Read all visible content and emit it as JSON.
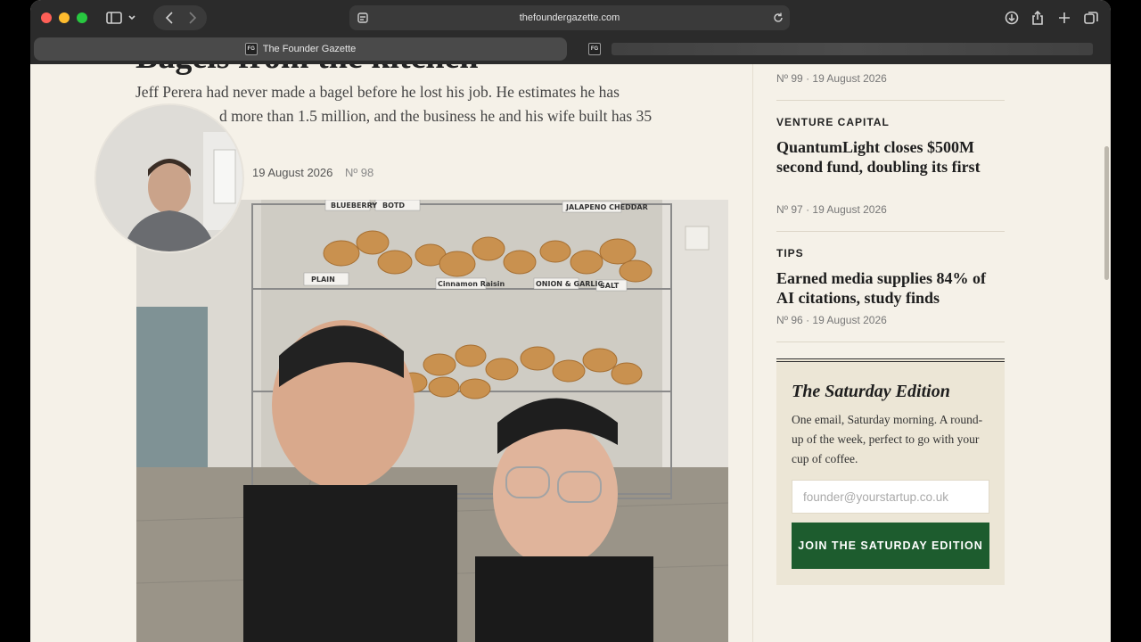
{
  "browser": {
    "url": "thefoundergazette.com",
    "tabs": [
      {
        "title": "The Founder Gazette",
        "favicon_text": "FG",
        "active": true
      },
      {
        "title": "",
        "favicon_text": "FG",
        "active": false
      }
    ]
  },
  "article": {
    "headline_partial": "Bagels from the kitchen",
    "standfirst_line1": "Jeff Perera had never made a bagel before he lost his job. He estimates he has",
    "standfirst_line2": "d more than 1.5 million, and the business he and his wife built has 35",
    "date": "19 August 2026",
    "issue": "Nº 98"
  },
  "sidebar": {
    "top_meta": "Nº 99 · 19 August 2026",
    "items": [
      {
        "category": "VENTURE CAPITAL",
        "title": "QuantumLight closes $500M second fund, doubling its first",
        "meta": "Nº 97 · 19 August 2026"
      },
      {
        "category": "TIPS",
        "title": "Earned media supplies 84% of AI citations, study finds",
        "meta": "Nº 96 · 19 August 2026"
      }
    ]
  },
  "newsletter": {
    "title": "The Saturday Edition",
    "body": "One email, Saturday morning. A round-up of the week, perfect to go with your cup of coffee.",
    "placeholder": "founder@yourstartup.co.uk",
    "button": "JOIN THE SATURDAY EDITION"
  },
  "photo": {
    "labels": [
      "BLUEBERRY",
      "BOTD",
      "JALAPENO CHEDDAR",
      "PLAIN",
      "Cinnamon Raisin",
      "ONION & GARLIC",
      "SALT"
    ]
  }
}
